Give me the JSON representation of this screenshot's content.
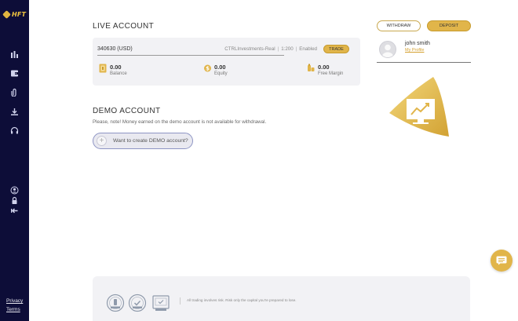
{
  "app": {
    "logo_text": "HFT"
  },
  "sidebar": {
    "icons": [
      "bar-chart-icon",
      "wallet-icon",
      "attachment-icon",
      "download-icon",
      "headset-icon",
      "user-icon",
      "lock-icon",
      "logout-icon"
    ],
    "links": {
      "privacy": "Privacy",
      "terms": "Terms"
    }
  },
  "live_account": {
    "title": "LIVE ACCOUNT",
    "account_id": "340630 (USD)",
    "server": "CTRLInvestments-Real",
    "leverage": "1:200",
    "status": "Enabled",
    "trade_label": "TRADE",
    "balance": {
      "value": "0.00",
      "label": "Balance"
    },
    "equity": {
      "value": "0.00",
      "label": "Equity"
    },
    "free_margin": {
      "value": "0.00",
      "label": "Free Margin"
    }
  },
  "demo_account": {
    "title": "DEMO ACCOUNT",
    "note": "Please, note! Money earned on the demo account is not available for withdrawal.",
    "create_label": "Want to create DEMO account?"
  },
  "actions": {
    "withdraw_label": "WITHDRAW",
    "deposit_label": "DEPOSIT"
  },
  "user": {
    "name": "john smith",
    "profile_link": "My Profile"
  },
  "footer": {
    "risk_text": "All trading involves risk. Risk only the capital you're prepared to lose."
  },
  "colors": {
    "sidebar": "#0d0d38",
    "accent_gold": "#e1b54a",
    "card_bg": "#f2f2f5"
  }
}
